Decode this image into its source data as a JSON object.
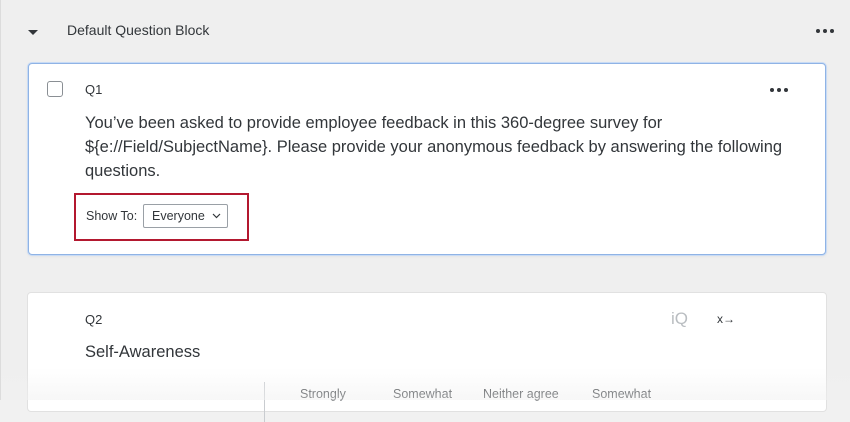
{
  "block": {
    "title": "Default Question Block"
  },
  "questions": [
    {
      "number": "Q1",
      "text": "You’ve been asked to provide employee feedback in this 360-degree survey for ${e://Field/SubjectName}. Please provide your anonymous feedback by answering the following questions.",
      "display": {
        "label": "Show To:",
        "value": "Everyone"
      }
    },
    {
      "number": "Q2",
      "text": "Self-Awareness",
      "icons": {
        "iq": "iQ",
        "transition": "x→"
      },
      "scale_headers": [
        "Strongly",
        "Somewhat",
        "Neither agree",
        "Somewhat"
      ]
    }
  ],
  "colors": {
    "highlight": "#b3182f",
    "selected_border": "#8fb3e5"
  },
  "icons": {
    "collapse": "caret-down-icon",
    "more": "ellipsis-icon",
    "select": "chevron-down-icon"
  }
}
